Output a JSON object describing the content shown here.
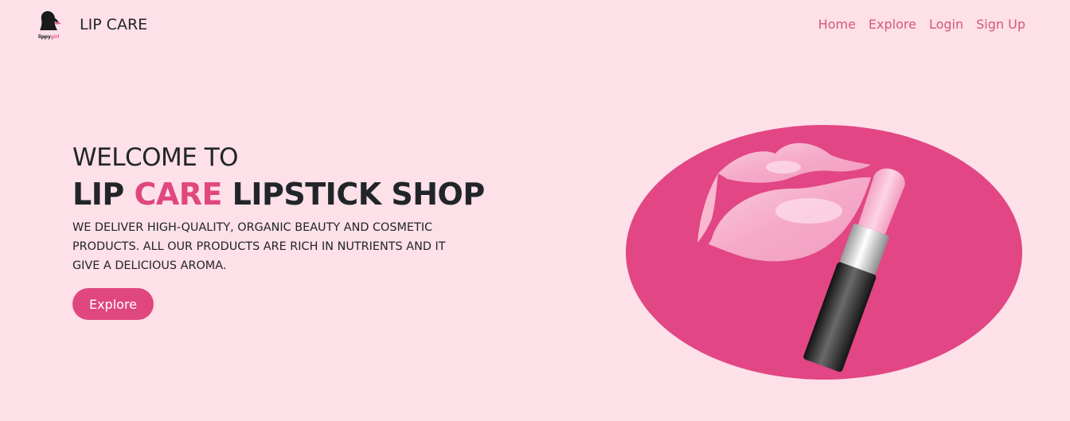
{
  "nav": {
    "brand_logo_line1": "lippy",
    "brand_logo_line2": "girl",
    "brand_name": "LIP CARE",
    "links": [
      "Home",
      "Explore",
      "Login",
      "Sign Up"
    ]
  },
  "hero": {
    "welcome": "WELCOME TO",
    "title_part1": "LIP ",
    "title_accent": "CARE",
    "title_part2": " LIPSTICK SHOP",
    "description": "WE DELIVER HIGH-QUALITY, ORGANIC BEAUTY AND COSMETIC PRODUCTS. ALL OUR PRODUCTS ARE RICH IN NUTRIENTS AND IT GIVE A DELICIOUS AROMA.",
    "button_label": "Explore",
    "illustration_icon": "lips-and-lipstick-illustration"
  },
  "colors": {
    "background": "#fde0e8",
    "accent": "#e0477f",
    "nav_link": "#d2587f"
  }
}
